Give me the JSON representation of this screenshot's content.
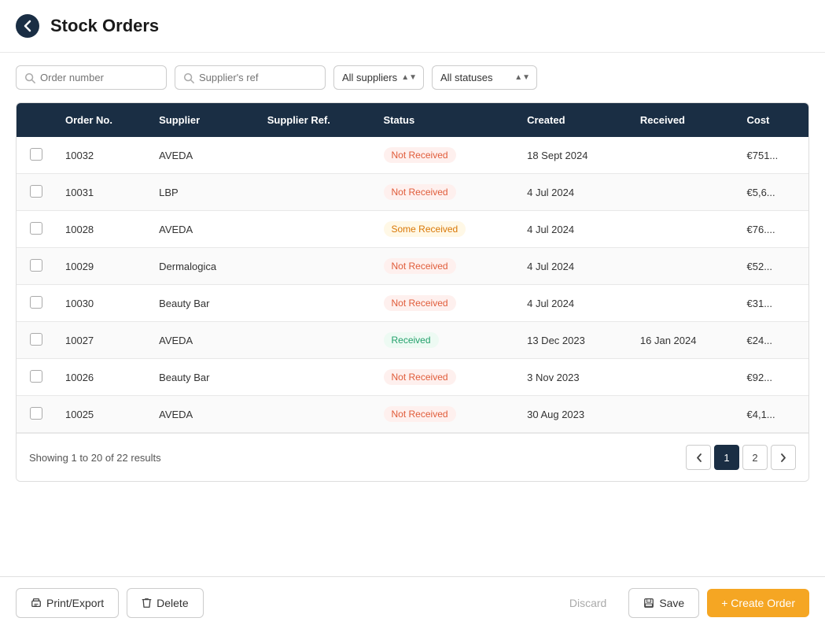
{
  "header": {
    "title": "Stock Orders",
    "back_label": "back"
  },
  "filters": {
    "order_number_placeholder": "Order number",
    "supplier_ref_placeholder": "Supplier's ref",
    "suppliers_label": "All suppliers",
    "statuses_label": "All statuses",
    "suppliers_options": [
      "All suppliers",
      "AVEDA",
      "LBP",
      "Dermalogica",
      "Beauty Bar"
    ],
    "statuses_options": [
      "All statuses",
      "Not Received",
      "Some Received",
      "Received"
    ]
  },
  "table": {
    "columns": [
      "",
      "Order No.",
      "Supplier",
      "Supplier Ref.",
      "Status",
      "Created",
      "Received",
      "Cost"
    ],
    "rows": [
      {
        "id": "10032",
        "supplier": "AVEDA",
        "supplier_ref": "",
        "status": "Not Received",
        "status_type": "not-received",
        "created": "18 Sept 2024",
        "received": "",
        "cost": "€751..."
      },
      {
        "id": "10031",
        "supplier": "LBP",
        "supplier_ref": "",
        "status": "Not Received",
        "status_type": "not-received",
        "created": "4 Jul 2024",
        "received": "",
        "cost": "€5,6..."
      },
      {
        "id": "10028",
        "supplier": "AVEDA",
        "supplier_ref": "",
        "status": "Some Received",
        "status_type": "some-received",
        "created": "4 Jul 2024",
        "received": "",
        "cost": "€76...."
      },
      {
        "id": "10029",
        "supplier": "Dermalogica",
        "supplier_ref": "",
        "status": "Not Received",
        "status_type": "not-received",
        "created": "4 Jul 2024",
        "received": "",
        "cost": "€52..."
      },
      {
        "id": "10030",
        "supplier": "Beauty Bar",
        "supplier_ref": "",
        "status": "Not Received",
        "status_type": "not-received",
        "created": "4 Jul 2024",
        "received": "",
        "cost": "€31..."
      },
      {
        "id": "10027",
        "supplier": "AVEDA",
        "supplier_ref": "",
        "status": "Received",
        "status_type": "received",
        "created": "13 Dec 2023",
        "received": "16 Jan 2024",
        "cost": "€24..."
      },
      {
        "id": "10026",
        "supplier": "Beauty Bar",
        "supplier_ref": "",
        "status": "Not Received",
        "status_type": "not-received",
        "created": "3 Nov 2023",
        "received": "",
        "cost": "€92..."
      },
      {
        "id": "10025",
        "supplier": "AVEDA",
        "supplier_ref": "",
        "status": "Not Received",
        "status_type": "not-received",
        "created": "30 Aug 2023",
        "received": "",
        "cost": "€4,1..."
      }
    ]
  },
  "pagination": {
    "info": "Showing 1 to 20 of 22 results",
    "current_page": 1,
    "pages": [
      1,
      2
    ]
  },
  "footer": {
    "print_export_label": "Print/Export",
    "delete_label": "Delete",
    "discard_label": "Discard",
    "save_label": "Save",
    "create_order_label": "+ Create Order"
  }
}
